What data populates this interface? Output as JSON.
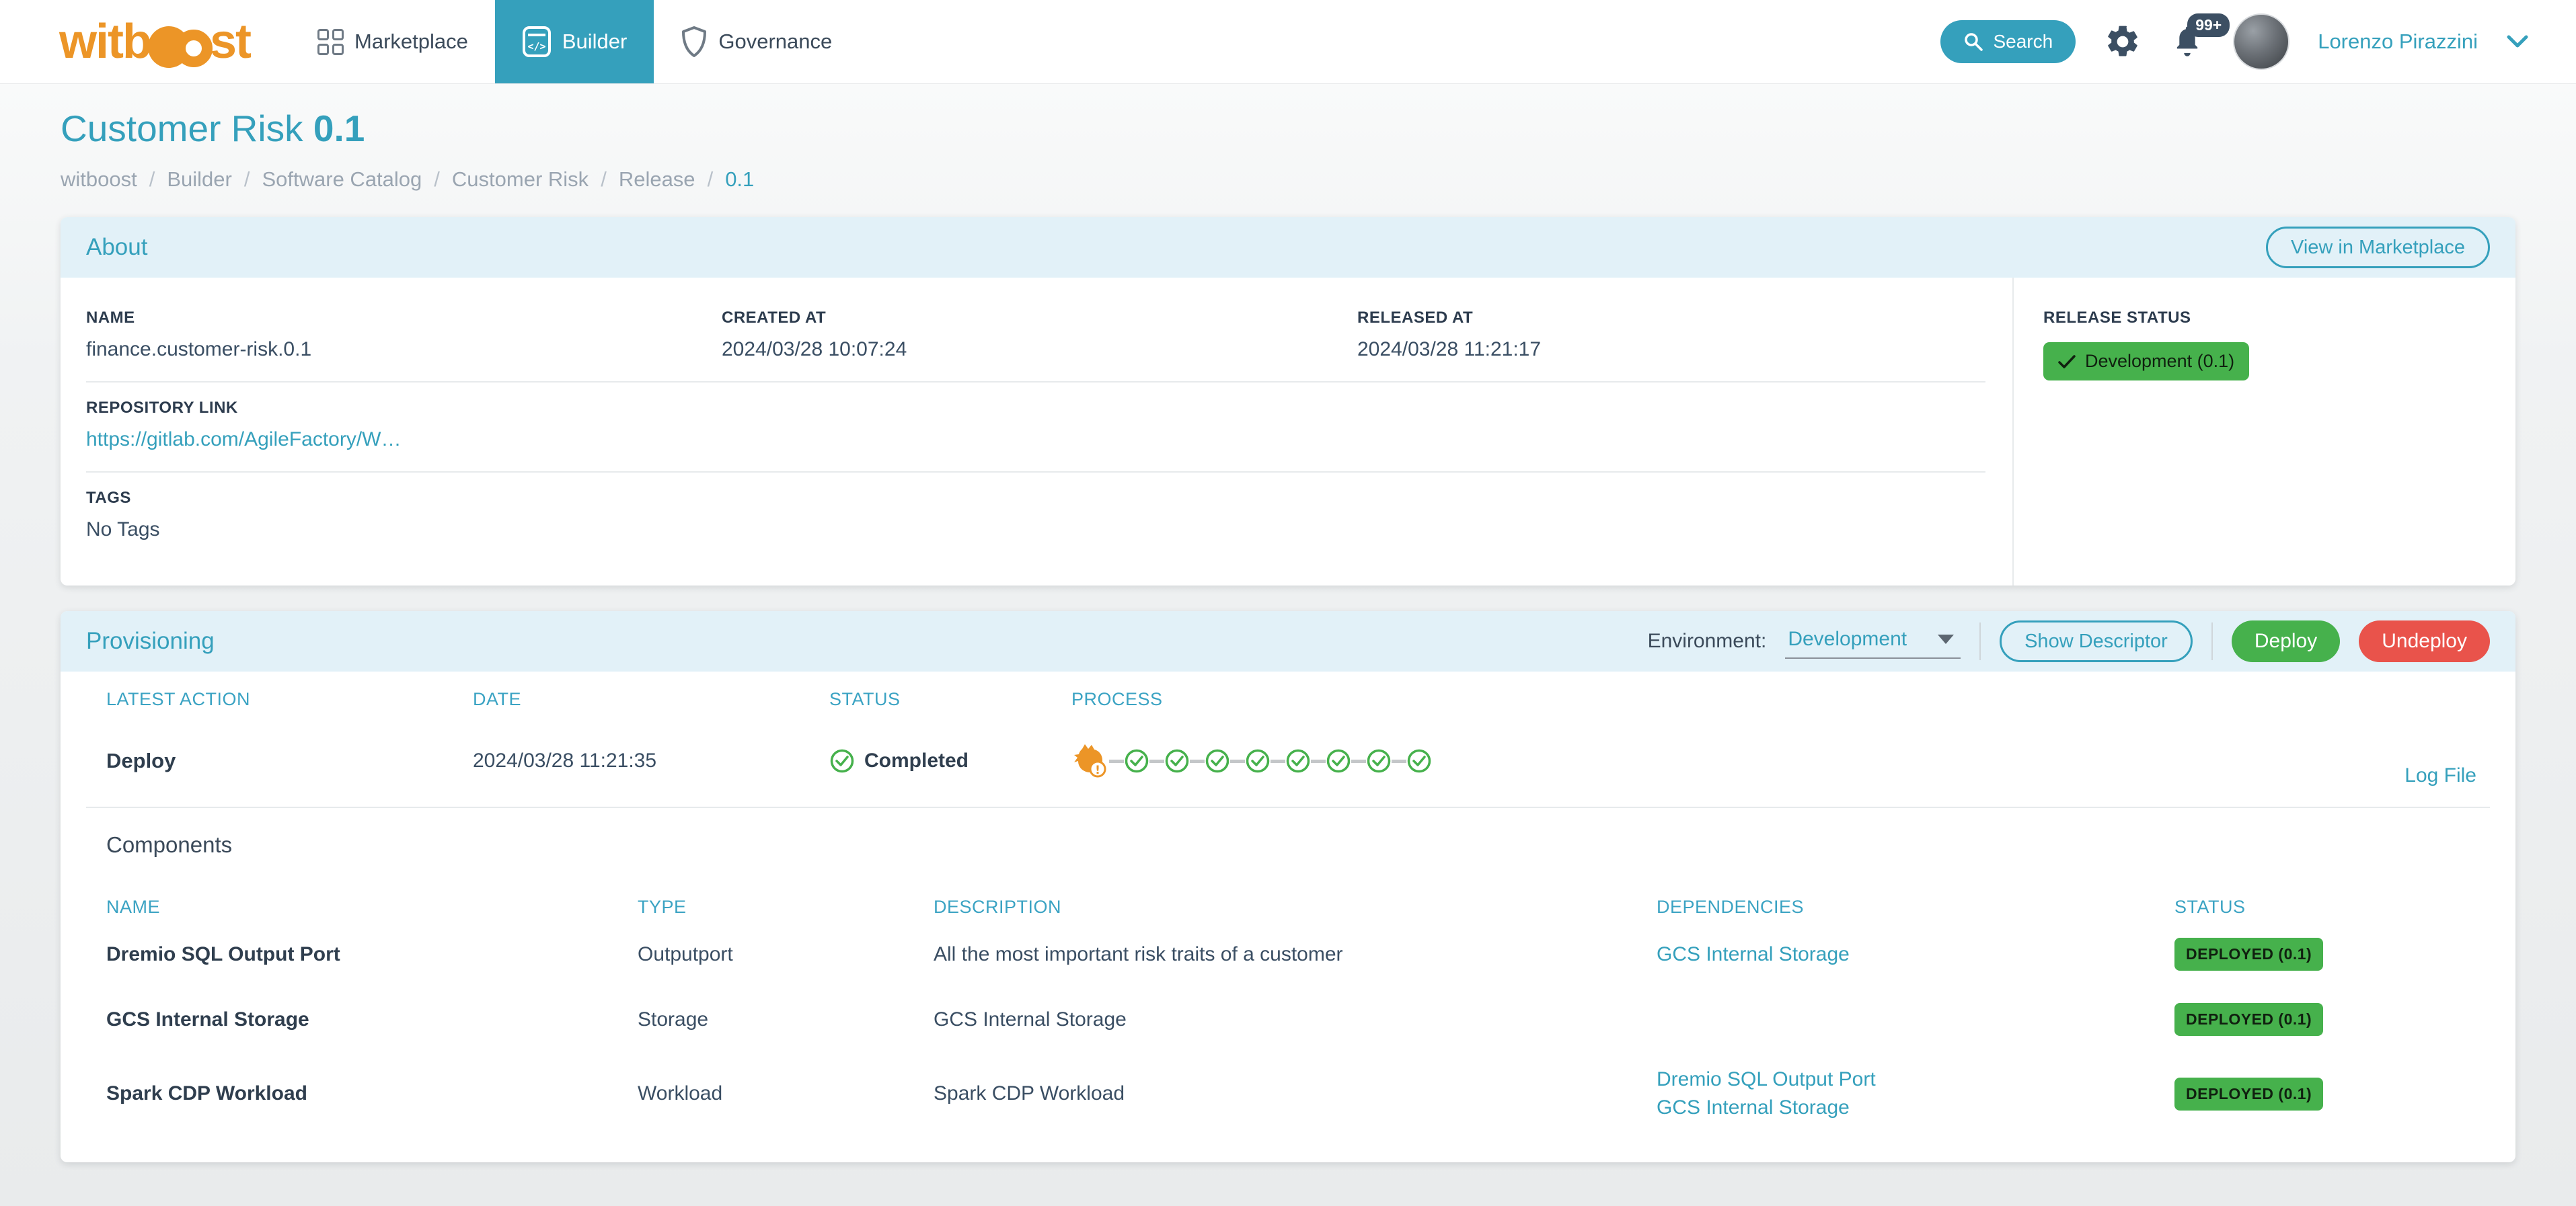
{
  "colors": {
    "teal": "#35a0bc",
    "green": "#46b14c",
    "red": "#e9534b",
    "orange": "#ec9527",
    "header_blue": "#e2f1f8"
  },
  "nav": {
    "logo_part1": "witb",
    "logo_part2": "st",
    "items": [
      {
        "label": "Marketplace",
        "icon": "grid-icon",
        "active": false
      },
      {
        "label": "Builder",
        "icon": "code-icon",
        "active": true
      },
      {
        "label": "Governance",
        "icon": "shield-icon",
        "active": false
      }
    ],
    "search_label": "Search",
    "notifications_badge": "99+",
    "user_name": "Lorenzo Pirazzini"
  },
  "page": {
    "title": "Customer Risk",
    "version": "0.1",
    "breadcrumb": [
      "witboost",
      "Builder",
      "Software Catalog",
      "Customer Risk",
      "Release",
      "0.1"
    ]
  },
  "about": {
    "header": "About",
    "view_in_marketplace": "View in Marketplace",
    "name_label": "NAME",
    "name_value": "finance.customer-risk.0.1",
    "created_label": "CREATED AT",
    "created_value": "2024/03/28 10:07:24",
    "released_label": "RELEASED AT",
    "released_value": "2024/03/28 11:21:17",
    "repo_label": "REPOSITORY LINK",
    "repo_value": "https://gitlab.com/AgileFactory/W…",
    "tags_label": "TAGS",
    "tags_value": "No Tags",
    "release_status_label": "RELEASE STATUS",
    "release_status_value": "Development (0.1)"
  },
  "provisioning": {
    "header": "Provisioning",
    "environment_label": "Environment:",
    "environment_value": "Development",
    "show_descriptor": "Show Descriptor",
    "deploy": "Deploy",
    "undeploy": "Undeploy",
    "latest": {
      "headers": [
        "LATEST ACTION",
        "DATE",
        "STATUS",
        "PROCESS"
      ],
      "action": "Deploy",
      "date": "2024/03/28 11:21:35",
      "status": "Completed",
      "process_first_icon": "witboost-mascot-warning-icon",
      "process_check_count": 8,
      "log_file": "Log File"
    },
    "components": {
      "title": "Components",
      "headers": [
        "NAME",
        "TYPE",
        "DESCRIPTION",
        "DEPENDENCIES",
        "STATUS"
      ],
      "rows": [
        {
          "name": "Dremio SQL Output Port",
          "type": "Outputport",
          "description": "All the most important risk traits of a customer",
          "dependencies": [
            "GCS Internal Storage"
          ],
          "status": "DEPLOYED (0.1)"
        },
        {
          "name": "GCS Internal Storage",
          "type": "Storage",
          "description": "GCS Internal Storage",
          "dependencies": [],
          "status": "DEPLOYED (0.1)"
        },
        {
          "name": "Spark CDP Workload",
          "type": "Workload",
          "description": "Spark CDP Workload",
          "dependencies": [
            "Dremio SQL Output Port",
            "GCS Internal Storage"
          ],
          "status": "DEPLOYED (0.1)"
        }
      ]
    }
  }
}
